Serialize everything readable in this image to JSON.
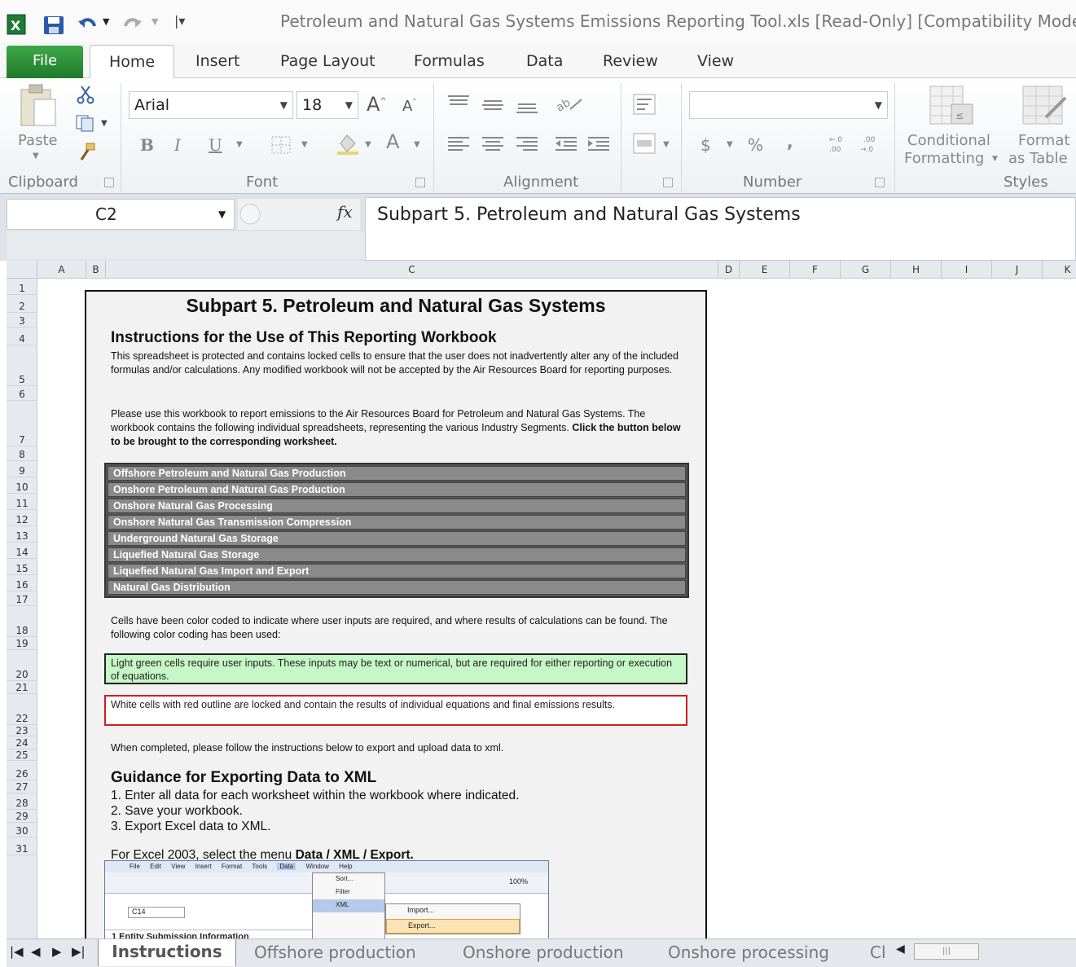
{
  "window": {
    "title": "Petroleum and Natural Gas Systems Emissions Reporting Tool.xls  [Read-Only]  [Compatibility Mode]"
  },
  "ribbon_tabs": [
    "File",
    "Home",
    "Insert",
    "Page Layout",
    "Formulas",
    "Data",
    "Review",
    "View"
  ],
  "active_tab": "Home",
  "ribbon": {
    "clipboard": {
      "paste_label": "Paste",
      "group_label": "Clipboard"
    },
    "font": {
      "font_name": "Arial",
      "font_size": "18",
      "group_label": "Font"
    },
    "alignment": {
      "group_label": "Alignment"
    },
    "number": {
      "format_value": "",
      "group_label": "Number",
      "currency_symbol": "$",
      "percent_symbol": "%",
      "comma_symbol": ","
    },
    "styles": {
      "conditional_label_1": "Conditional",
      "conditional_label_2": "Formatting",
      "format_label_1": "Format",
      "format_label_2": "as Table",
      "group_label": "Styles"
    }
  },
  "formula_bar": {
    "name_box": "C2",
    "fx": "fx",
    "content": "Subpart 5. Petroleum and Natural Gas Systems"
  },
  "columns": [
    "A",
    "B",
    "C",
    "D",
    "E",
    "F",
    "G",
    "H",
    "I",
    "J",
    "K"
  ],
  "rows": [
    "1",
    "2",
    "3",
    "4",
    "5",
    "6",
    "7",
    "8",
    "9",
    "10",
    "11",
    "12",
    "13",
    "14",
    "15",
    "16",
    "17",
    "18",
    "19",
    "20",
    "21",
    "22",
    "23",
    "24",
    "25",
    "26",
    "27",
    "28",
    "29",
    "30",
    "31"
  ],
  "sheet": {
    "title": "Subpart 5. Petroleum and Natural Gas Systems",
    "instructions_heading": "Instructions for the Use of This Reporting Workbook",
    "para1": "This spreadsheet is protected and contains locked cells to ensure that the user does not inadvertently alter any of the included formulas and/or calculations. Any modified workbook will not be accepted by the Air Resources Board for reporting purposes.",
    "para2": "Please use this workbook to report emissions to the Air Resources Board for Petroleum and Natural Gas Systems. The workbook contains the following individual spreadsheets, representing the various Industry Segments.",
    "para2_bold": "Click the button below to be brought to the corresponding worksheet.",
    "nav_buttons": [
      "Offshore Petroleum and Natural Gas Production",
      "Onshore Petroleum and Natural Gas Production",
      "Onshore Natural Gas Processing",
      "Onshore Natural Gas Transmission Compression",
      "Underground Natural Gas Storage",
      "Liquefied Natural Gas Storage",
      "Liquefied Natural Gas Import and Export",
      "Natural Gas Distribution"
    ],
    "color_coding_text": "Cells have been color coded to indicate where user inputs are required, and where results of calculations can be found. The following color coding has been used:",
    "green_box_text": "Light green cells require user inputs. These inputs may be text or numerical, but are required for either reporting or execution of equations.",
    "red_box_text": "White cells with red outline are locked and contain the results of individual equations and final emissions results.",
    "export_note": "When completed, please follow the instructions below to export and upload data to xml.",
    "guidance_heading": "Guidance for Exporting Data to XML",
    "steps": [
      "1.  Enter all data for each worksheet within the workbook where indicated.",
      "2.  Save your workbook.",
      "3.  Export Excel data to XML."
    ],
    "excel2003_prefix": "For Excel 2003,  select the menu ",
    "excel2003_bold": "Data / XML / Export.",
    "mini_screenshot": {
      "menu": [
        "File",
        "Edit",
        "View",
        "Insert",
        "Format",
        "Tools",
        "Data",
        "Window",
        "Help"
      ],
      "zoom": "100%",
      "name_box": "C14",
      "data_menu": [
        "Sort...",
        "Filter",
        "XML",
        ""
      ],
      "xml_submenu": [
        "Import...",
        "Export..."
      ],
      "row1": "1  Entity Submission Information"
    }
  },
  "sheet_tabs": [
    "Instructions",
    "Offshore production",
    "Onshore production",
    "Onshore processing",
    "Cl"
  ],
  "active_sheet": "Instructions"
}
